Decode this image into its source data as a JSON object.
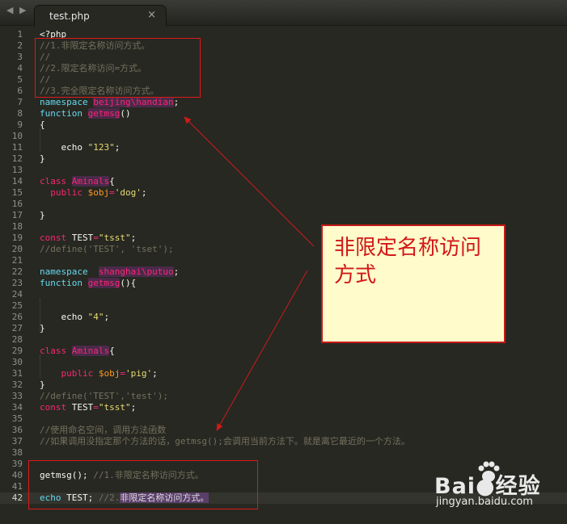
{
  "editor": {
    "nav": {
      "back_icon": "◀",
      "forward_icon": "▶"
    },
    "tab": {
      "title": "test.php",
      "close_glyph": "×"
    },
    "active_line": 42,
    "lines": [
      {
        "n": "1",
        "t": [
          [
            "",
            "<?php"
          ]
        ]
      },
      {
        "n": "2",
        "t": [
          [
            "c",
            "//1.非限定名称访问方式。"
          ]
        ]
      },
      {
        "n": "3",
        "t": [
          [
            "c",
            "//"
          ]
        ]
      },
      {
        "n": "4",
        "t": [
          [
            "c",
            "//2.限定名称访问=方式。"
          ]
        ]
      },
      {
        "n": "5",
        "t": [
          [
            "c",
            "//"
          ]
        ]
      },
      {
        "n": "6",
        "t": [
          [
            "c",
            "//3.完全限定名称访问方式。"
          ]
        ]
      },
      {
        "n": "7",
        "t": [
          [
            "k",
            "namespace"
          ],
          [
            "",
            " "
          ],
          [
            "f hm",
            "beijing\\handian"
          ],
          [
            "",
            ";"
          ]
        ]
      },
      {
        "n": "8",
        "t": [
          [
            "k",
            "function"
          ],
          [
            "",
            " "
          ],
          [
            "f hm",
            "getmsg"
          ],
          [
            "",
            "()"
          ]
        ]
      },
      {
        "n": "9",
        "t": [
          [
            "",
            "{"
          ]
        ]
      },
      {
        "n": "10",
        "t": []
      },
      {
        "n": "11",
        "t": [
          [
            "",
            "    echo "
          ],
          [
            "s",
            "\"123\""
          ],
          [
            "",
            ";"
          ]
        ]
      },
      {
        "n": "12",
        "t": [
          [
            "",
            "}"
          ]
        ]
      },
      {
        "n": "13",
        "t": []
      },
      {
        "n": "14",
        "t": [
          [
            "f",
            "class"
          ],
          [
            "",
            " "
          ],
          [
            "f hm",
            "Aminals"
          ],
          [
            "",
            "{"
          ]
        ]
      },
      {
        "n": "15",
        "t": [
          [
            "",
            "  "
          ],
          [
            "f",
            "public"
          ],
          [
            "",
            " "
          ],
          [
            "v",
            "$obj"
          ],
          [
            "f",
            "="
          ],
          [
            "s",
            "'dog'"
          ],
          [
            "",
            ";"
          ]
        ]
      },
      {
        "n": "16",
        "t": []
      },
      {
        "n": "17",
        "t": [
          [
            "",
            "}"
          ]
        ]
      },
      {
        "n": "18",
        "t": []
      },
      {
        "n": "19",
        "t": [
          [
            "f",
            "const"
          ],
          [
            "",
            " TEST"
          ],
          [
            "f",
            "="
          ],
          [
            "s",
            "\"tsst\""
          ],
          [
            "",
            ";"
          ]
        ]
      },
      {
        "n": "20",
        "t": [
          [
            "c",
            "//define('TEST', 'tset');"
          ]
        ]
      },
      {
        "n": "21",
        "t": []
      },
      {
        "n": "22",
        "t": [
          [
            "k",
            "namespace"
          ],
          [
            "",
            "  "
          ],
          [
            "f hm",
            "shanghai\\putuo"
          ],
          [
            "",
            ";"
          ]
        ]
      },
      {
        "n": "23",
        "t": [
          [
            "k",
            "function"
          ],
          [
            "",
            " "
          ],
          [
            "f hm",
            "getmsg"
          ],
          [
            "",
            "(){"
          ]
        ]
      },
      {
        "n": "24",
        "t": []
      },
      {
        "n": "25",
        "t": []
      },
      {
        "n": "26",
        "t": [
          [
            "",
            "    echo "
          ],
          [
            "s",
            "\"4\""
          ],
          [
            "",
            ";"
          ]
        ]
      },
      {
        "n": "27",
        "t": [
          [
            "",
            "}"
          ]
        ]
      },
      {
        "n": "28",
        "t": []
      },
      {
        "n": "29",
        "t": [
          [
            "f",
            "class"
          ],
          [
            "",
            " "
          ],
          [
            "f hm",
            "Aminals"
          ],
          [
            "",
            "{"
          ]
        ]
      },
      {
        "n": "30",
        "t": []
      },
      {
        "n": "31",
        "t": [
          [
            "",
            "    "
          ],
          [
            "f",
            "public"
          ],
          [
            "",
            " "
          ],
          [
            "v",
            "$obj"
          ],
          [
            "f",
            "="
          ],
          [
            "s",
            "'pig'"
          ],
          [
            "",
            ";"
          ]
        ]
      },
      {
        "n": "32",
        "t": [
          [
            "",
            "}"
          ]
        ]
      },
      {
        "n": "33",
        "t": [
          [
            "c",
            "//define('TEST','test');"
          ]
        ]
      },
      {
        "n": "34",
        "t": [
          [
            "f",
            "const"
          ],
          [
            "",
            " TEST"
          ],
          [
            "f",
            "="
          ],
          [
            "s",
            "\"tsst\""
          ],
          [
            "",
            ";"
          ]
        ]
      },
      {
        "n": "35",
        "t": []
      },
      {
        "n": "36",
        "t": [
          [
            "c",
            "//使用命名空间，调用方法函数"
          ]
        ]
      },
      {
        "n": "37",
        "t": [
          [
            "c",
            "//如果调用没指定那个方法的话，getmsg();会调用当前方法下。就是离它最近的一个方法。"
          ]
        ]
      },
      {
        "n": "38",
        "t": []
      },
      {
        "n": "39",
        "t": []
      },
      {
        "n": "40",
        "t": [
          [
            "",
            "getmsg(); "
          ],
          [
            "c",
            "//1.非限定名称访问方式。"
          ]
        ]
      },
      {
        "n": "41",
        "t": []
      },
      {
        "n": "42",
        "t": [
          [
            "k",
            "echo"
          ],
          [
            "",
            " TEST; "
          ],
          [
            "c",
            "//2."
          ],
          [
            "sel",
            "非限定名称访问方式。"
          ]
        ]
      }
    ]
  },
  "annotation": {
    "note_text": "非限定名称访问方式",
    "colors": {
      "box": "#e01818",
      "note_bg": "#fffbcb",
      "arrow": "#cc1a1a"
    }
  },
  "watermark": {
    "brand": "Bai●经验",
    "site": "jingyan.baidu.com",
    "icon": "paw-icon"
  }
}
